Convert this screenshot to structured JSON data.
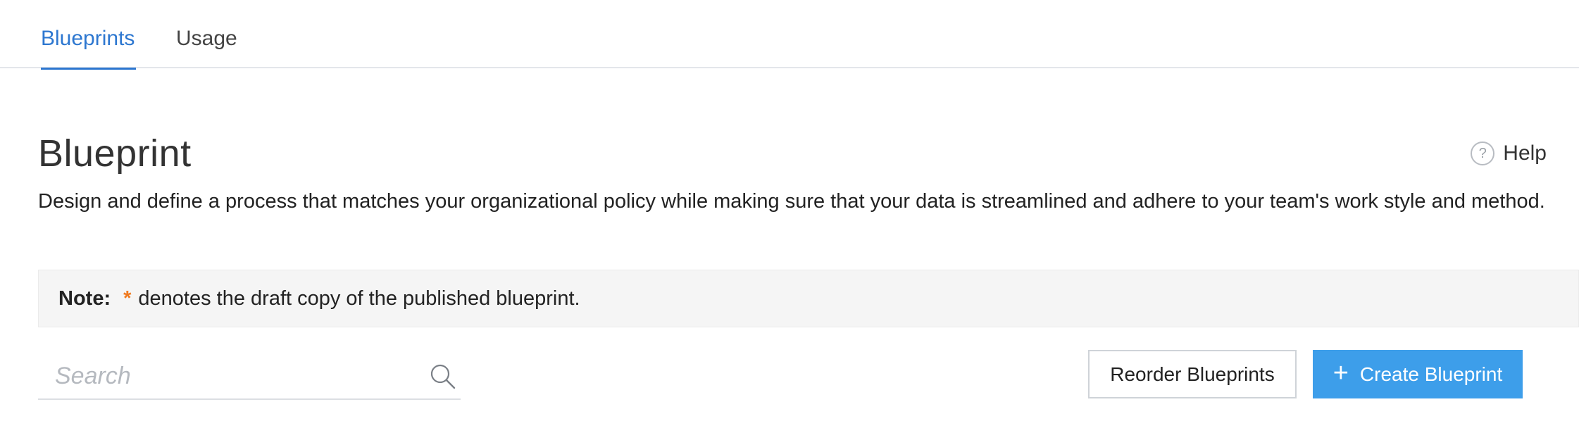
{
  "tabs": [
    {
      "label": "Blueprints",
      "active": true
    },
    {
      "label": "Usage",
      "active": false
    }
  ],
  "header": {
    "title": "Blueprint",
    "help_label": "Help",
    "help_icon": "question-circle-icon",
    "description": "Design and define a process that matches your organizational policy while making sure that your data is streamlined and adhere to your team's work style and method."
  },
  "note": {
    "label": "Note:",
    "marker": "*",
    "text": "denotes the draft copy of the published blueprint."
  },
  "search": {
    "placeholder": "Search",
    "value": "",
    "icon": "search-icon"
  },
  "actions": {
    "reorder_label": "Reorder Blueprints",
    "create_label": "Create Blueprint",
    "create_icon": "plus-icon"
  },
  "colors": {
    "accent": "#2d77d0",
    "primary_button": "#3d9eea",
    "note_marker": "#f07a1f",
    "note_background": "#f5f5f5"
  }
}
